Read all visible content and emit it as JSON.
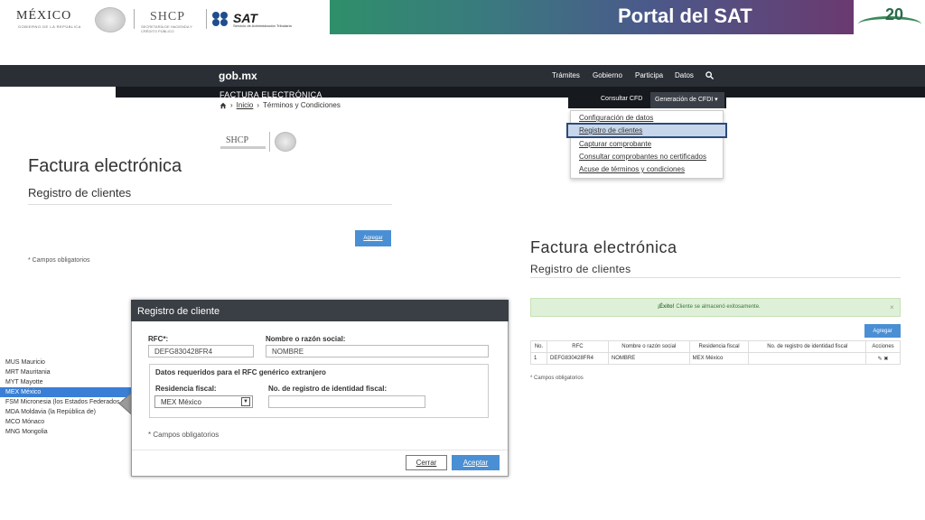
{
  "banner": {
    "mexico": "MÉXICO",
    "mexico_sub": "GOBIERNO DE LA REPÚBLICA",
    "shcp": "SHCP",
    "shcp_sub": "SECRETARÍA DE HACIENDA Y CRÉDITO PÚBLICO",
    "sat": "SAT",
    "sat_sub": "Servicio de Administración Tributaria",
    "title": "Portal del SAT",
    "anniversary": "20",
    "colors": {
      "band_start": "#2f8f6a",
      "band_end": "#6a3a70"
    }
  },
  "navbar": {
    "brand": "gob.mx",
    "items": [
      "Trámites",
      "Gobierno",
      "Participa",
      "Datos"
    ],
    "search_icon": "search-icon",
    "section": "FACTURA ELECTRÓNICA",
    "subnav": [
      "Consultar CFD",
      "Generación de CFDI"
    ]
  },
  "breadcrumb": {
    "home_icon": "home-icon",
    "inicio": "Inicio",
    "current": "Términos y Condiciones"
  },
  "dropdown": {
    "items": [
      "Configuración de datos",
      "Registro de clientes",
      "Capturar comprobante",
      "Consultar comprobantes no certificados",
      "Acuse de términos y condiciones"
    ],
    "highlighted": "Registro de clientes"
  },
  "left": {
    "title": "Factura electrónica",
    "subtitle": "Registro de clientes",
    "add_button": "Agregar",
    "required": "* Campos obligatorios"
  },
  "countries": {
    "items": [
      "MUS Mauricio",
      "MRT Mauritania",
      "MYT Mayotte",
      "MEX México",
      "FSM Micronesia (los Estados Federados de)",
      "MDA Moldavia (la República de)",
      "MCO Mónaco",
      "MNG Mongolia"
    ],
    "selected": "MEX México"
  },
  "modal": {
    "title": "Registro de cliente",
    "rfc_label": "RFC*:",
    "rfc_value": "DEFG830428FR4",
    "name_label": "Nombre o razón social:",
    "name_value": "NOMBRE",
    "fieldset_legend": "Datos requeridos para el RFC genérico extranjero",
    "residence_label": "Residencia fiscal:",
    "residence_value": "MEX México",
    "reg_label": "No. de registro de identidad fiscal:",
    "reg_value": "",
    "required": "* Campos obligatorios",
    "cancel": "Cerrar",
    "accept": "Aceptar"
  },
  "right": {
    "title": "Factura electrónica",
    "subtitle": "Registro de clientes",
    "alert_strong": "¡Éxito!",
    "alert_text": " Cliente se almacenó exitosamente.",
    "alert_close": "×",
    "add_button": "Agregar",
    "table": {
      "headers": [
        "No.",
        "RFC",
        "Nombre o razón social",
        "Residencia fiscal",
        "No. de registro de identidad fiscal",
        "Acciones"
      ],
      "rows": [
        [
          "1",
          "DEFG830428FR4",
          "NOMBRE",
          "MEX México",
          "",
          "✎ ✖"
        ]
      ]
    },
    "required": "* Campos obligatorios"
  }
}
